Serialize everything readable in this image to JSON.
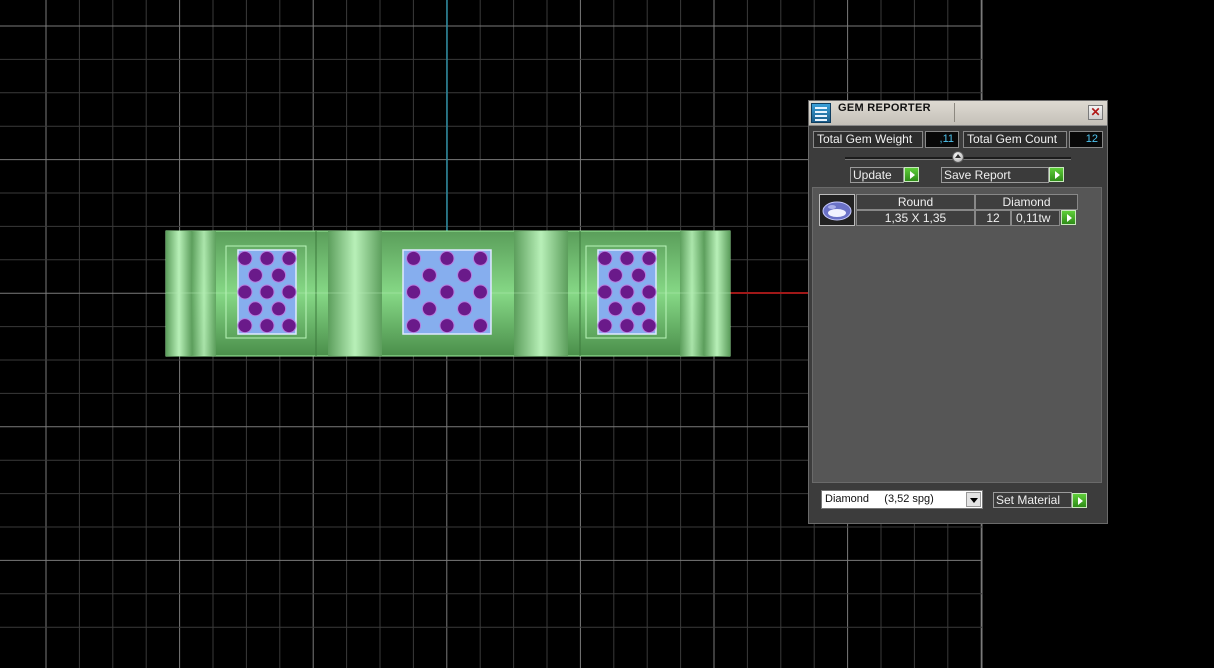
{
  "panel": {
    "title": "GEM REPORTER",
    "close_glyph": "✕",
    "total_weight_label": "Total Gem Weight",
    "total_weight_value": ",11",
    "total_count_label": "Total Gem Count",
    "total_count_value": "12",
    "update_label": "Update",
    "save_report_label": "Save Report",
    "table_headers": [
      "Round",
      "Diamond"
    ],
    "rows": [
      {
        "size": "1,35 X 1,35",
        "count": "12",
        "weight": "0,11tw"
      }
    ],
    "material_selected": "Diamond     (3,52 spg)",
    "set_material_label": "Set Material"
  },
  "icons": {
    "app": "gem-reporter-icon",
    "close": "close-icon",
    "slider": "slider-thumb",
    "arrow": "play-arrow-icon",
    "dropdown": "chevron-down-icon",
    "gem": "round-gem-icon"
  },
  "colors": {
    "background": "#000000",
    "grid": "#3a3a3a",
    "grid_major": "#7a7a7a",
    "axis_y": "#2a8aa0",
    "axis_x": "#a01818",
    "ring_metal": "#7ed97e",
    "gem_blue": "#86aeee",
    "gem_purple": "#6a1a8a",
    "value_text": "#4fc3ee",
    "panel_bg": "#3c3c3c",
    "arrow_green": "#3fae22"
  }
}
